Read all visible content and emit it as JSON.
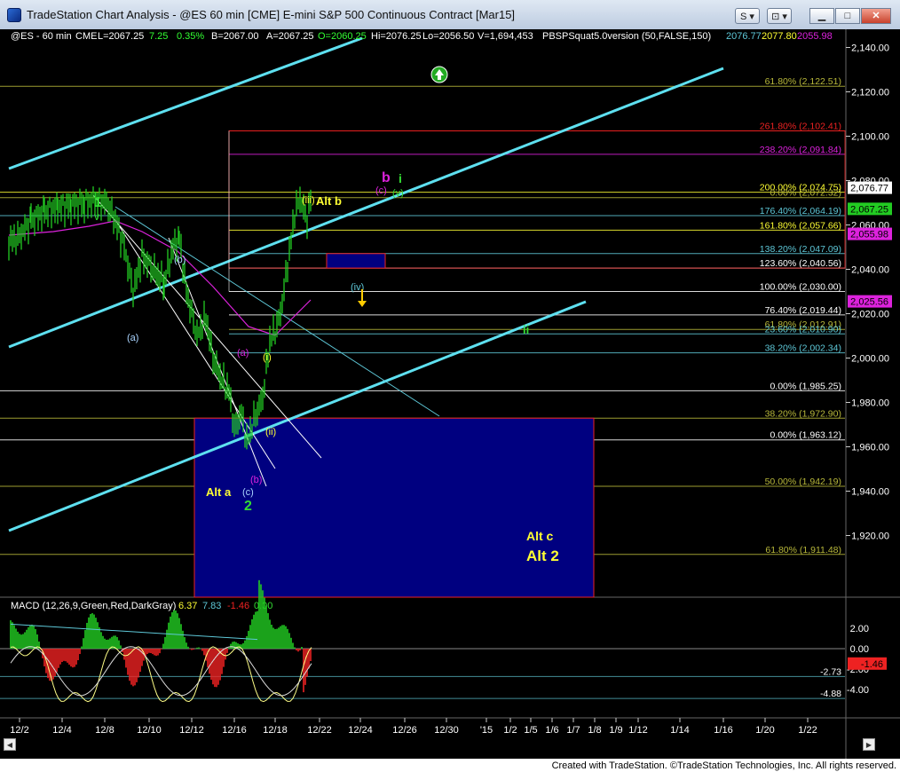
{
  "window": {
    "title": "TradeStation Chart Analysis - @ES 60 min [CME] E-mini S&P 500 Continuous Contract [Mar15]",
    "buttons": {
      "s_menu": "S ▾",
      "tools_menu": "⊡ ▾",
      "minimize": "▁",
      "maximize": "□",
      "close": "✕"
    }
  },
  "colors": {
    "background": "#000000",
    "bars": "#22cc22",
    "channel": "#5ee0f0",
    "fib_olive": "#b8b83a",
    "fib_cyan": "#5ec8d8",
    "magenta": "#dd22dd",
    "red_box": "#ee2222",
    "target_box": "#000080",
    "label_yellow": "#ffff33",
    "label_green": "#33dd33",
    "macd_pos": "#22cc22",
    "macd_neg": "#ee2222"
  },
  "info_line": {
    "symbol": "@ES - 60 min",
    "exchange": "CME",
    "last": "L=2067.25",
    "change": "7.25",
    "pct": "0.35%",
    "bid": "B=2067.00",
    "ask": "A=2067.25",
    "open": "O=2060.25",
    "high": "Hi=2076.25",
    "low": "Lo=2056.50",
    "volume": "V=1,694,453",
    "indicator": "PBSPSquat5.0version (50,FALSE,150)",
    "ind_v1": "2076.77",
    "ind_v2": "2077.80",
    "ind_v3": "2055.98"
  },
  "price_axis": {
    "ticks": [
      "2,140.00",
      "2,120.00",
      "2,100.00",
      "2,080.00",
      "2,060.00",
      "2,040.00",
      "2,020.00",
      "2,000.00",
      "1,980.00",
      "1,960.00",
      "1,940.00",
      "1,920.00"
    ],
    "tick_values": [
      2140,
      2120,
      2100,
      2080,
      2060,
      2040,
      2020,
      2000,
      1980,
      1960,
      1940,
      1920
    ],
    "badges": [
      {
        "text": "2,076.77",
        "value": 2076.77,
        "color": "#ffffff",
        "text_color": "#000000"
      },
      {
        "text": "2,067.25",
        "value": 2067.25,
        "color": "#22cc22",
        "text_color": "#000000"
      },
      {
        "text": "2,055.98",
        "value": 2055.98,
        "color": "#dd22dd",
        "text_color": "#000000"
      },
      {
        "text": "2,025.56",
        "value": 2025.56,
        "color": "#dd22dd",
        "text_color": "#000000"
      }
    ]
  },
  "fib_levels": [
    {
      "label": "61.80% (2,122.51)",
      "value": 2122.51,
      "color": "#b8b83a",
      "x0": 0.0
    },
    {
      "label": "261.80% (2,102.41)",
      "value": 2102.41,
      "color": "#ee2222",
      "x0": 0.27
    },
    {
      "label": "238.20% (2,091.84)",
      "value": 2091.84,
      "color": "#dd22dd",
      "x0": 0.27
    },
    {
      "label": "200.00% (2,074.75)",
      "value": 2074.75,
      "color": "#ffff33",
      "x0": 0.0
    },
    {
      "label": "0.00% (2,072.32)",
      "value": 2072.32,
      "color": "#b8b83a",
      "x0": 0.0
    },
    {
      "label": "176.40% (2,064.19)",
      "value": 2064.19,
      "color": "#5ec8d8",
      "x0": 0.0
    },
    {
      "label": "161.80% (2,057.66)",
      "value": 2057.66,
      "color": "#ffff33",
      "x0": 0.27
    },
    {
      "label": "138.20% (2,047.09)",
      "value": 2047.09,
      "color": "#5ec8d8",
      "x0": 0.27
    },
    {
      "label": "123.60% (2,040.56)",
      "value": 2040.56,
      "color": "#ffffff",
      "x0": 0.27
    },
    {
      "label": "100.00% (2,030.00)",
      "value": 2030.0,
      "color": "#ffffff",
      "x0": 0.27
    },
    {
      "label": "76.40% (2,019.44)",
      "value": 2019.44,
      "color": "#ffffff",
      "x0": 0.27
    },
    {
      "label": "61.80% (2,012.91)",
      "value": 2012.91,
      "color": "#b8b83a",
      "x0": 0.27
    },
    {
      "label": "23.60% (2,010.90)",
      "value": 2010.9,
      "color": "#5ec8d8",
      "x0": 0.27
    },
    {
      "label": "38.20% (2,002.34)",
      "value": 2002.34,
      "color": "#5ec8d8",
      "x0": 0.27
    },
    {
      "label": "0.00% (1,985.25)",
      "value": 1985.25,
      "color": "#ffffff",
      "x0": 0.0
    },
    {
      "label": "38.20% (1,972.90)",
      "value": 1972.9,
      "color": "#b8b83a",
      "x0": 0.0
    },
    {
      "label": "0.00% (1,963.12)",
      "value": 1963.12,
      "color": "#ffffff",
      "x0": 0.0
    },
    {
      "label": "50.00% (1,942.19)",
      "value": 1942.19,
      "color": "#b8b83a",
      "x0": 0.0
    },
    {
      "label": "61.80% (1,911.48)",
      "value": 1911.48,
      "color": "#b8b83a",
      "x0": 0.0
    }
  ],
  "wave_labels": [
    {
      "text": "1",
      "color": "#33dd33",
      "bold": true,
      "size": 16
    },
    {
      "text": "v",
      "color": "#33dd33",
      "bold": false,
      "size": 12
    },
    {
      "text": "(b)",
      "color": "#aad4ff",
      "bold": false,
      "size": 11
    },
    {
      "text": "(a)",
      "color": "#aad4ff",
      "bold": false,
      "size": 11
    },
    {
      "text": "(a)",
      "color": "#dd22dd",
      "bold": false,
      "size": 11
    },
    {
      "text": "(i)",
      "color": "#ffff33",
      "bold": false,
      "size": 11
    },
    {
      "text": "(ii)",
      "color": "#ffff33",
      "bold": false,
      "size": 11
    },
    {
      "text": "(iii)",
      "color": "#ffff33",
      "bold": false,
      "size": 11
    },
    {
      "text": "Alt b",
      "color": "#ffff33",
      "bold": true,
      "size": 13
    },
    {
      "text": "b",
      "color": "#dd22dd",
      "bold": true,
      "size": 16
    },
    {
      "text": "(c)",
      "color": "#dd22dd",
      "bold": false,
      "size": 11
    },
    {
      "text": "i",
      "color": "#33dd33",
      "bold": true,
      "size": 14
    },
    {
      "text": "(v)",
      "color": "#33dd33",
      "bold": false,
      "size": 11
    },
    {
      "text": "(iv)",
      "color": "#5ec8d8",
      "bold": false,
      "size": 11
    },
    {
      "text": "ii",
      "color": "#33dd33",
      "bold": true,
      "size": 13
    },
    {
      "text": "Alt a",
      "color": "#ffff33",
      "bold": true,
      "size": 13
    },
    {
      "text": "(c)",
      "color": "#aad4ff",
      "bold": false,
      "size": 11
    },
    {
      "text": "(b)",
      "color": "#dd22dd",
      "bold": false,
      "size": 11
    },
    {
      "text": "2",
      "color": "#33dd33",
      "bold": true,
      "size": 16
    },
    {
      "text": "Alt c",
      "color": "#ffff33",
      "bold": true,
      "size": 14
    },
    {
      "text": "Alt 2",
      "color": "#ffff33",
      "bold": true,
      "size": 17
    }
  ],
  "macd": {
    "label": "MACD (12,26,9,Green,Red,DarkGray)",
    "v1": "6.37",
    "v2": "7.83",
    "v3": "-1.46",
    "v4": "0.00",
    "ticks": [
      "2.00",
      "0.00",
      "-2.00",
      "-4.00"
    ],
    "tick_values": [
      2,
      0,
      -2,
      -4
    ],
    "level_labels": [
      "-2.73",
      "-4.88"
    ],
    "level_values": [
      -2.73,
      -4.88
    ],
    "badge": "-1.46",
    "badge_value": -1.46
  },
  "time_axis": [
    "12/2",
    "12/4",
    "12/8",
    "12/10",
    "12/12",
    "12/16",
    "12/18",
    "12/22",
    "12/24",
    "12/26",
    "12/30",
    "'15",
    "1/2",
    "1/5",
    "1/6",
    "1/7",
    "1/8",
    "1/9",
    "1/12",
    "1/14",
    "1/16",
    "1/20",
    "1/22"
  ],
  "footer": "Created with TradeStation. ©TradeStation Technologies, Inc. All rights reserved."
}
